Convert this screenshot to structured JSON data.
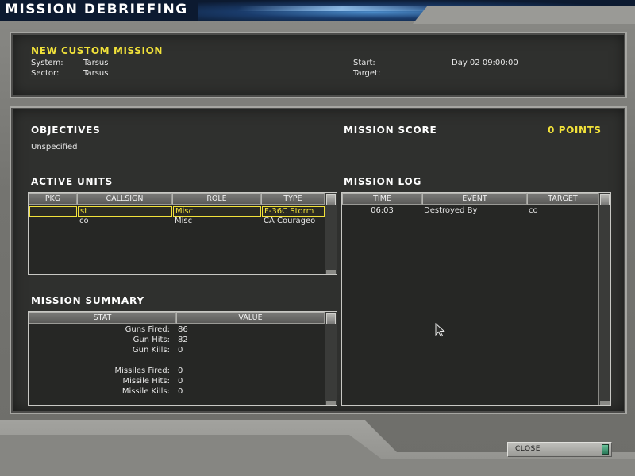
{
  "window": {
    "title": "MISSION DEBRIEFING"
  },
  "header": {
    "mission_name": "NEW CUSTOM MISSION",
    "system_label": "System:",
    "system_value": "Tarsus",
    "sector_label": "Sector:",
    "sector_value": "Tarsus",
    "start_label": "Start:",
    "start_value": "Day 02 09:00:00",
    "target_label": "Target:",
    "target_value": ""
  },
  "objectives": {
    "title": "OBJECTIVES",
    "text": "Unspecified"
  },
  "score": {
    "title": "MISSION SCORE",
    "value": "0 POINTS"
  },
  "active_units": {
    "title": "ACTIVE UNITS",
    "columns": [
      "PKG",
      "CALLSIGN",
      "ROLE",
      "TYPE"
    ],
    "rows": [
      {
        "pkg": "",
        "callsign": "st",
        "role": "Misc",
        "type": "F-36C Storm",
        "selected": true
      },
      {
        "pkg": "",
        "callsign": "co",
        "role": "Misc",
        "type": "CA Courageo",
        "selected": false
      }
    ]
  },
  "mission_log": {
    "title": "MISSION LOG",
    "columns": [
      "TIME",
      "EVENT",
      "TARGET"
    ],
    "rows": [
      {
        "time": "06:03",
        "event": "Destroyed By",
        "target": "co"
      }
    ]
  },
  "mission_summary": {
    "title": "MISSION SUMMARY",
    "columns": [
      "STAT",
      "VALUE"
    ],
    "rows": [
      {
        "stat": "Guns Fired:",
        "value": "86"
      },
      {
        "stat": "Gun Hits:",
        "value": "82"
      },
      {
        "stat": "Gun Kills:",
        "value": "0"
      },
      {
        "stat": "",
        "value": ""
      },
      {
        "stat": "Missiles Fired:",
        "value": "0"
      },
      {
        "stat": "Missile Hits:",
        "value": "0"
      },
      {
        "stat": "Missile Kills:",
        "value": "0"
      }
    ]
  },
  "buttons": {
    "close_label": "CLOSE"
  },
  "colors": {
    "accent_yellow": "#f2e23a",
    "panel_dark": "#2f302e",
    "indicator_green": "#4aa27a"
  }
}
